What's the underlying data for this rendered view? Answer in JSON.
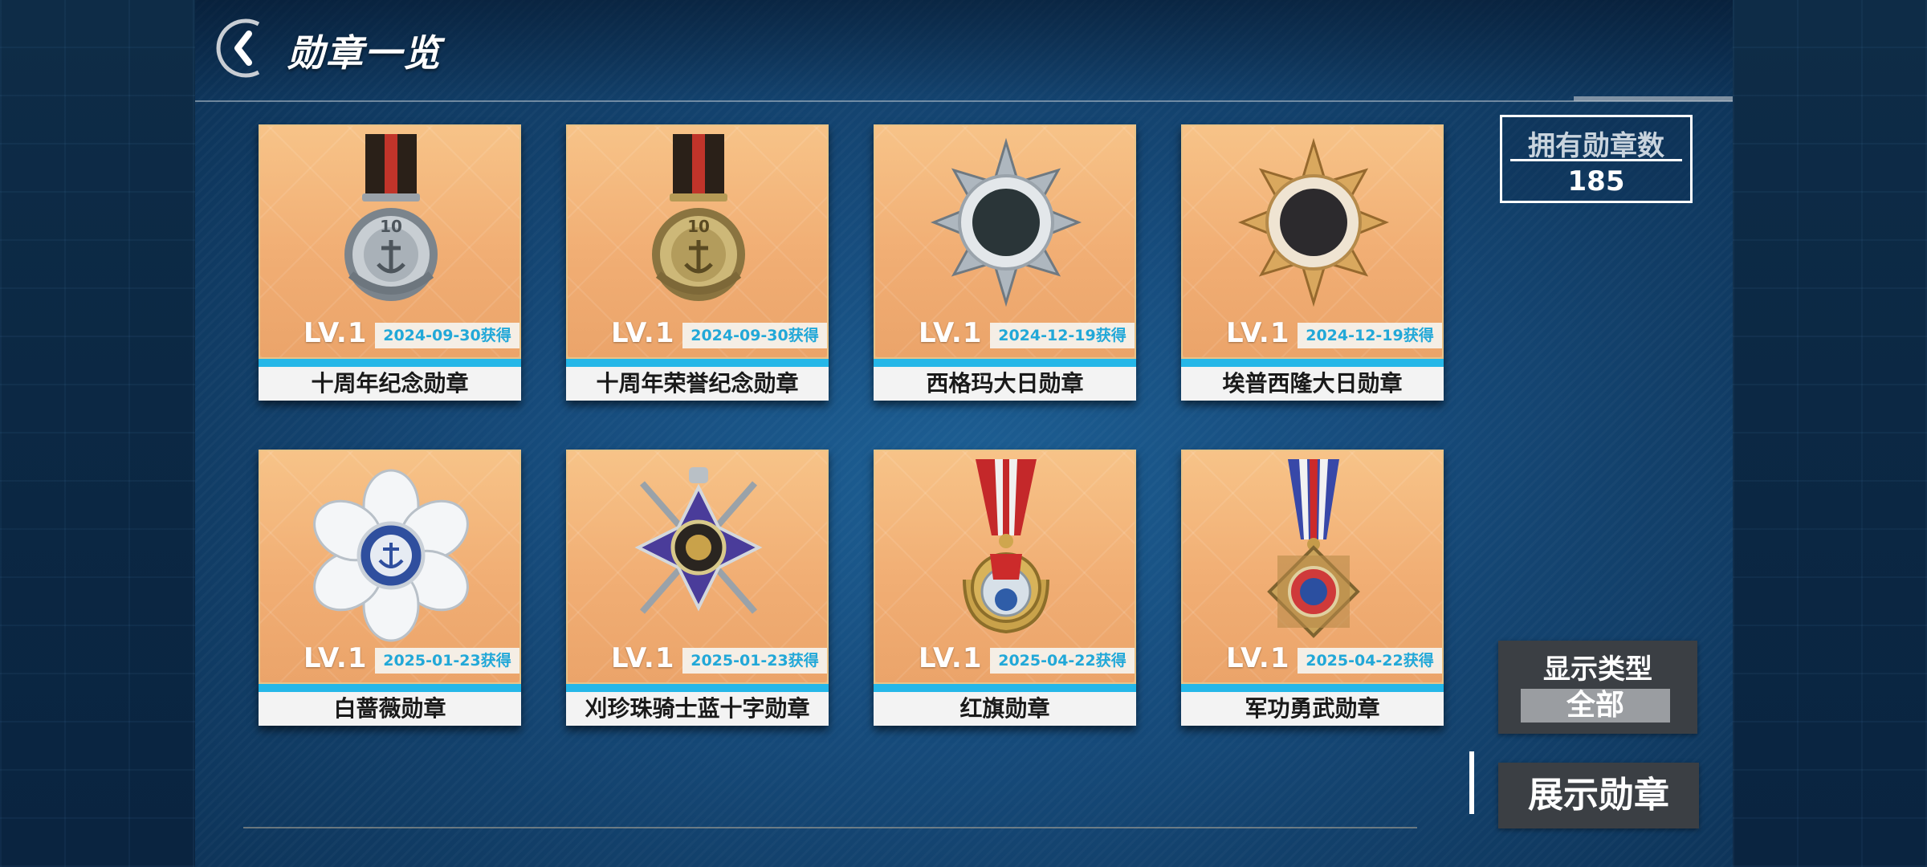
{
  "header": {
    "title": "勋章一览"
  },
  "count": {
    "label": "拥有勋章数",
    "value": "185"
  },
  "medals": [
    {
      "level": "LV.1",
      "date": "2024-09-30获得",
      "name": "十周年纪念勋章",
      "ribbon": "dark-red-stripe",
      "color": "silver"
    },
    {
      "level": "LV.1",
      "date": "2024-09-30获得",
      "name": "十周年荣誉纪念勋章",
      "ribbon": "dark-red-stripe",
      "color": "gold"
    },
    {
      "level": "LV.1",
      "date": "2024-12-19获得",
      "name": "西格玛大日勋章",
      "ribbon": "none",
      "color": "silver"
    },
    {
      "level": "LV.1",
      "date": "2024-12-19获得",
      "name": "埃普西隆大日勋章",
      "ribbon": "none",
      "color": "gold"
    },
    {
      "level": "LV.1",
      "date": "2025-01-23获得",
      "name": "白蔷薇勋章",
      "ribbon": "none",
      "color": "white"
    },
    {
      "level": "LV.1",
      "date": "2025-01-23获得",
      "name": "刈珍珠骑士蓝十字勋章",
      "ribbon": "none",
      "color": "purple"
    },
    {
      "level": "LV.1",
      "date": "2025-04-22获得",
      "name": "红旗勋章",
      "ribbon": "red-white-stripe",
      "color": "red"
    },
    {
      "level": "LV.1",
      "date": "2025-04-22获得",
      "name": "军功勇武勋章",
      "ribbon": "blue-red-white-stripe",
      "color": "bronze"
    }
  ],
  "filter": {
    "label": "显示类型",
    "value": "全部"
  },
  "showcase": {
    "label": "展示勋章"
  },
  "colors": {
    "accent_cyan": "#25b7e8",
    "card_bg": "#f1ae74",
    "button_bg": "#3b3f44"
  }
}
